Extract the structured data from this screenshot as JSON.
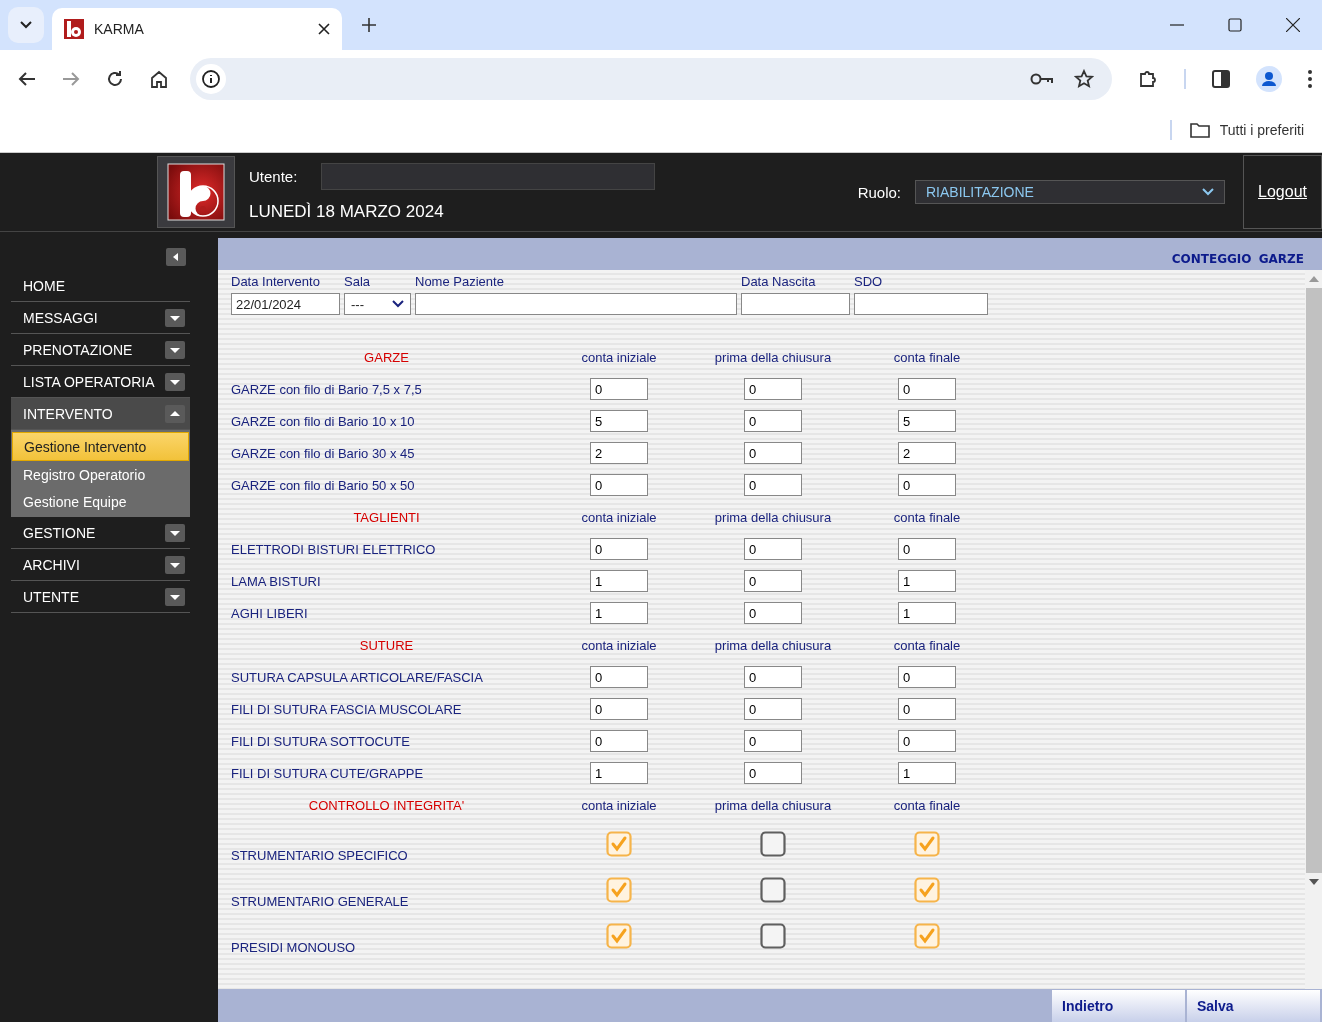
{
  "browser": {
    "tab_title": "KARMA",
    "bookmarks_label": "Tutti i preferiti"
  },
  "header": {
    "user_label": "Utente:",
    "date": "LUNEDÌ 18 MARZO 2024",
    "role_label": "Ruolo:",
    "role_value": "RIABILITAZIONE",
    "logout": "Logout"
  },
  "sidebar": {
    "items": [
      {
        "label": "HOME",
        "kind": "link",
        "expanded": false
      },
      {
        "label": "MESSAGGI",
        "kind": "menu",
        "expanded": false
      },
      {
        "label": "PRENOTAZIONE",
        "kind": "menu",
        "expanded": false
      },
      {
        "label": "LISTA OPERATORIA",
        "kind": "menu",
        "expanded": false
      },
      {
        "label": "INTERVENTO",
        "kind": "menu",
        "expanded": true,
        "children": [
          {
            "label": "Gestione Intervento",
            "selected": true
          },
          {
            "label": "Registro Operatorio",
            "selected": false
          },
          {
            "label": "Gestione Equipe",
            "selected": false
          }
        ]
      },
      {
        "label": "GESTIONE",
        "kind": "menu",
        "expanded": false
      },
      {
        "label": "ARCHIVI",
        "kind": "menu",
        "expanded": false
      },
      {
        "label": "UTENTE",
        "kind": "menu",
        "expanded": false
      }
    ]
  },
  "panel": {
    "title": "CONTEGGIO GARZE",
    "fields": [
      {
        "label": "Data Intervento",
        "kind": "text",
        "value": "22/01/2024"
      },
      {
        "label": "Sala",
        "kind": "select",
        "value": "---"
      },
      {
        "label": "Nome Paziente",
        "kind": "text"
      },
      {
        "label": "Data Nascita",
        "kind": "text"
      },
      {
        "label": "SDO",
        "kind": "text"
      }
    ],
    "sections": [
      {
        "title": "GARZE",
        "columns": [
          "conta iniziale",
          "prima della chiusura",
          "conta finale"
        ],
        "rows": [
          {
            "label": "GARZE con filo di Bario 7,5 x 7,5",
            "kind": "number",
            "values": [
              "0",
              "0",
              "0"
            ]
          },
          {
            "label": "GARZE con filo di Bario 10 x 10",
            "kind": "number",
            "values": [
              "5",
              "0",
              "5"
            ]
          },
          {
            "label": "GARZE con filo di Bario 30 x 45",
            "kind": "number",
            "values": [
              "2",
              "0",
              "2"
            ]
          },
          {
            "label": "GARZE con filo di Bario 50 x 50",
            "kind": "number",
            "values": [
              "0",
              "0",
              "0"
            ]
          }
        ]
      },
      {
        "title": "TAGLIENTI",
        "columns": [
          "conta iniziale",
          "prima della chiusura",
          "conta finale"
        ],
        "rows": [
          {
            "label": "ELETTRODI BISTURI ELETTRICO",
            "kind": "number",
            "values": [
              "0",
              "0",
              "0"
            ]
          },
          {
            "label": "LAMA BISTURI",
            "kind": "number",
            "values": [
              "1",
              "0",
              "1"
            ]
          },
          {
            "label": "AGHI LIBERI",
            "kind": "number",
            "values": [
              "1",
              "0",
              "1"
            ]
          }
        ]
      },
      {
        "title": "SUTURE",
        "columns": [
          "conta iniziale",
          "prima della chiusura",
          "conta finale"
        ],
        "rows": [
          {
            "label": "SUTURA CAPSULA ARTICOLARE/FASCIA",
            "kind": "number",
            "values": [
              "0",
              "0",
              "0"
            ]
          },
          {
            "label": "FILI DI SUTURA FASCIA MUSCOLARE",
            "kind": "number",
            "values": [
              "0",
              "0",
              "0"
            ]
          },
          {
            "label": "FILI DI SUTURA SOTTOCUTE",
            "kind": "number",
            "values": [
              "0",
              "0",
              "0"
            ]
          },
          {
            "label": "FILI DI SUTURA CUTE/GRAPPE",
            "kind": "number",
            "values": [
              "1",
              "0",
              "1"
            ]
          }
        ]
      },
      {
        "title": "CONTROLLO INTEGRITA'",
        "columns": [
          "conta iniziale",
          "prima della chiusura",
          "conta finale"
        ],
        "rows": [
          {
            "label": "STRUMENTARIO SPECIFICO",
            "kind": "check",
            "checked": [
              true,
              false,
              true
            ]
          },
          {
            "label": "STRUMENTARIO GENERALE",
            "kind": "check",
            "checked": [
              true,
              false,
              true
            ]
          },
          {
            "label": "PRESIDI MONOUSO",
            "kind": "check",
            "checked": [
              true,
              false,
              true
            ]
          }
        ]
      }
    ],
    "buttons": [
      "Indietro",
      "Salva"
    ]
  }
}
